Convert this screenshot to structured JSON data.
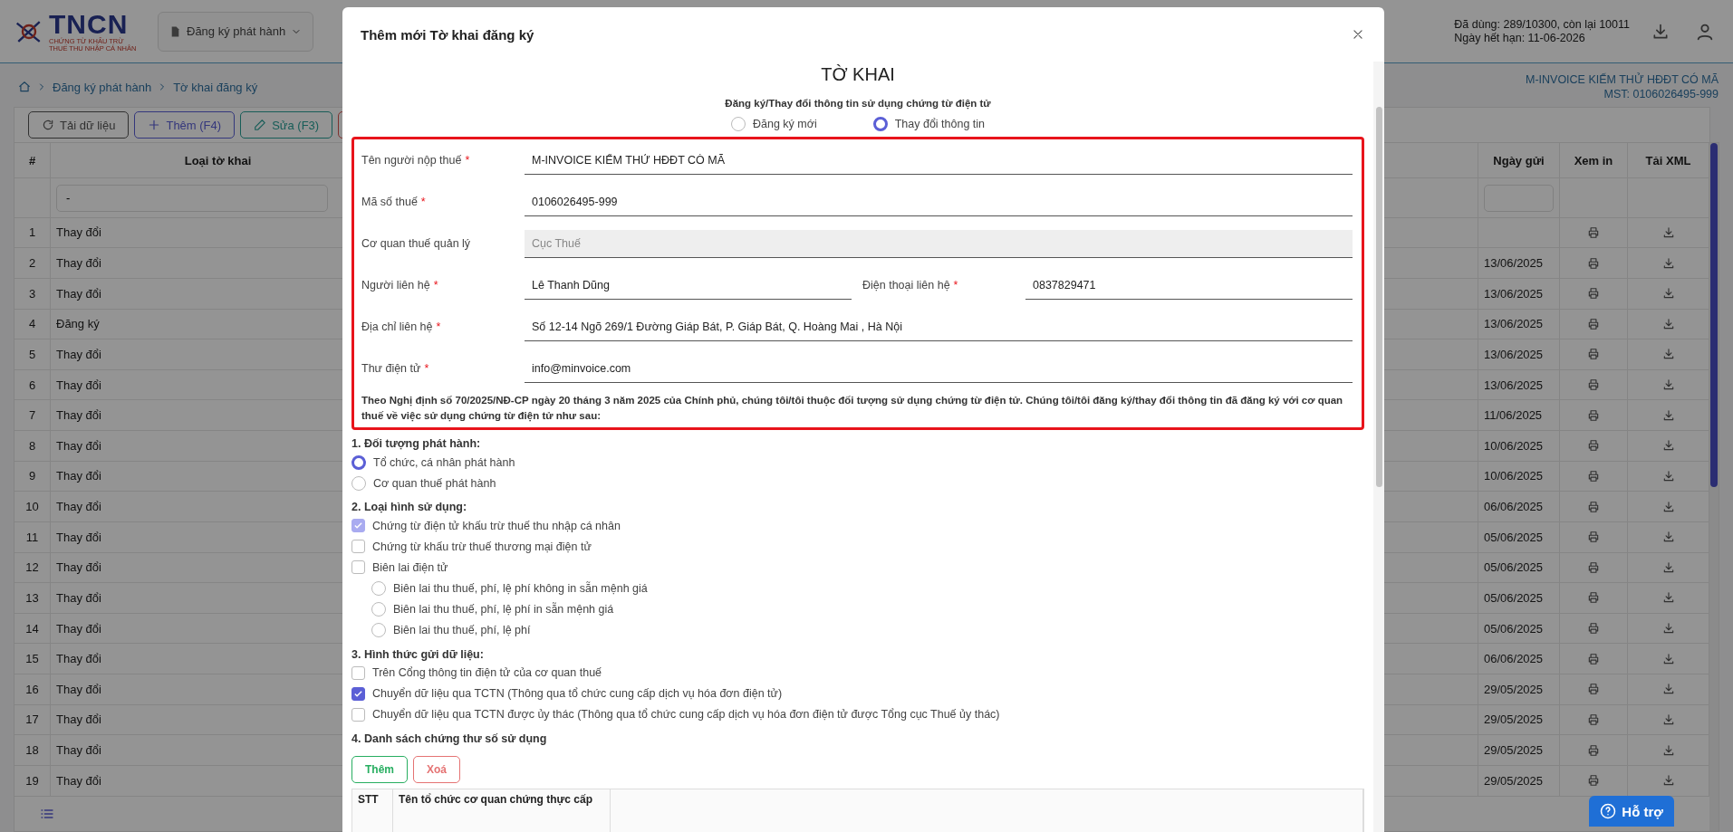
{
  "header": {
    "logo_text": "TNCN",
    "logo_tagline": "CHỨNG TỪ KHẤU TRỪ THUẾ THU NHẬP CÁ NHÂN",
    "menu_button": "Đăng ký phát hành",
    "usage": "Đã dùng: 289/10300, còn lại 10011",
    "expiry": "Ngày hết hạn: 11-06-2026"
  },
  "breadcrumb": [
    "Đăng ký phát hành",
    "Tờ khai đăng ký"
  ],
  "company": {
    "name": "M-INVOICE KIẾM THỬ HĐĐT CÓ MÃ",
    "tax_code": "MST: 0106026495-999"
  },
  "toolbar": [
    {
      "kind": "reload",
      "label": "Tải dữ liệu"
    },
    {
      "kind": "add",
      "label": "Thêm (F4)"
    },
    {
      "kind": "edit",
      "label": "Sửa (F3)"
    },
    {
      "kind": "delete"
    }
  ],
  "table": {
    "columns": [
      "#",
      "Loại tờ khai",
      "Ngày gửi",
      "Xem in",
      "Tải XML"
    ],
    "filter_value": "-",
    "rows": [
      {
        "no": "1",
        "type": "Thay đổi"
      },
      {
        "no": "2",
        "type": "Thay đổi",
        "date": "13/06/2025"
      },
      {
        "no": "3",
        "type": "Thay đổi",
        "date": "13/06/2025"
      },
      {
        "no": "4",
        "type": "Đăng ký",
        "date": "13/06/2025"
      },
      {
        "no": "5",
        "type": "Thay đổi",
        "date": "13/06/2025"
      },
      {
        "no": "6",
        "type": "Thay đổi",
        "date": "13/06/2025"
      },
      {
        "no": "7",
        "type": "Thay đổi",
        "date": "11/06/2025"
      },
      {
        "no": "8",
        "type": "Thay đổi",
        "date": "10/06/2025"
      },
      {
        "no": "9",
        "type": "Thay đổi",
        "date": "10/06/2025"
      },
      {
        "no": "10",
        "type": "Thay đổi",
        "date": "06/06/2025"
      },
      {
        "no": "11",
        "type": "Thay đổi",
        "date": "05/06/2025"
      },
      {
        "no": "12",
        "type": "Thay đổi",
        "date": "05/06/2025"
      },
      {
        "no": "13",
        "type": "Thay đổi",
        "date": "05/06/2025"
      },
      {
        "no": "14",
        "type": "Thay đổi",
        "date": "05/06/2025"
      },
      {
        "no": "15",
        "type": "Thay đổi",
        "date": "06/06/2025"
      },
      {
        "no": "16",
        "type": "Thay đổi",
        "date": "29/05/2025"
      },
      {
        "no": "17",
        "type": "Thay đổi",
        "date": "29/05/2025"
      },
      {
        "no": "18",
        "type": "Thay đổi",
        "date": "29/05/2025"
      },
      {
        "no": "19",
        "type": "Thay đổi",
        "date": "29/05/2025"
      }
    ]
  },
  "help_button": "Hỗ trợ",
  "modal": {
    "title": "Thêm mới Tờ khai đăng ký",
    "heading": "TỜ KHAI",
    "subtitle": "Đăng ký/Thay đổi thông tin sử dụng chứng từ điện tử",
    "mode_options": [
      {
        "label": "Đăng ký mới",
        "selected": false
      },
      {
        "label": "Thay đổi thông tin",
        "selected": true
      }
    ],
    "field_rows": [
      [
        {
          "label": "Tên người nộp thuế",
          "required_mark": "*",
          "value": "M-INVOICE KIẾM THỬ HĐĐT CÓ MÃ",
          "disabled": false
        }
      ],
      [
        {
          "label": "Mã số thuế",
          "required_mark": "*",
          "value": "0106026495-999",
          "disabled": false
        }
      ],
      [
        {
          "label": "Cơ quan thuế quản lý",
          "value": "Cục Thuế",
          "disabled": true
        }
      ],
      [
        {
          "label": "Người liên hệ",
          "required_mark": "*",
          "value": "Lê Thanh Dũng",
          "disabled": false
        },
        {
          "label": "Điện thoại liên hệ",
          "required_mark": "*",
          "value": "0837829471",
          "disabled": false
        }
      ],
      [
        {
          "label": "Địa chỉ liên hệ",
          "required_mark": "*",
          "value": "Số 12-14 Ngõ 269/1 Đường Giáp Bát, P. Giáp Bát, Q. Hoàng Mai , Hà Nội",
          "disabled": false
        }
      ],
      [
        {
          "label": "Thư điện tử",
          "required_mark": "*",
          "value": "info@minvoice.com",
          "disabled": false
        }
      ]
    ],
    "declaration": "Theo Nghị định số 70/2025/NĐ-CP ngày 20 tháng 3 năm 2025 của Chính phủ, chúng tôi/tôi thuộc đối tượng sử dụng chứng từ điện tử. Chúng tôi/tôi đăng ký/thay đổi thông tin đã đăng ký với cơ quan thuế về việc sử dụng chứng từ điện tử như sau:",
    "sections": [
      {
        "title": "1. Đối tượng phát hành:",
        "options": [
          {
            "kind": "radio",
            "label": "Tổ chức, cá nhân phát hành",
            "checked": true
          },
          {
            "kind": "radio",
            "label": "Cơ quan thuế phát hành",
            "checked": false
          }
        ]
      },
      {
        "title": "2. Loại hình sử dụng:",
        "options": [
          {
            "kind": "checkbox",
            "label": "Chứng từ điện tử khấu trừ thuế thu nhập cá nhân",
            "checked": true,
            "disabled": true
          },
          {
            "kind": "checkbox",
            "label": "Chứng từ khấu trừ thuế thương mại điện tử",
            "checked": false,
            "disabled": false
          },
          {
            "kind": "checkbox",
            "label": "Biên lai điện tử",
            "checked": false,
            "disabled": false,
            "children": [
              {
                "kind": "radio",
                "label": "Biên lai thu thuế, phí, lệ phí không in sẵn mệnh giá",
                "checked": false
              },
              {
                "kind": "radio",
                "label": "Biên lai thu thuế, phí, lệ phí in sẵn mệnh giá",
                "checked": false
              },
              {
                "kind": "radio",
                "label": "Biên lai thu thuế, phí, lệ phí",
                "checked": false
              }
            ]
          }
        ]
      },
      {
        "title": "3. Hình thức gửi dữ liệu:",
        "options": [
          {
            "kind": "checkbox",
            "label": "Trên Cổng thông tin điện tử của cơ quan thuế",
            "checked": false,
            "disabled": false
          },
          {
            "kind": "checkbox",
            "label": "Chuyển dữ liệu qua TCTN (Thông qua tổ chức cung cấp dịch vụ hóa đơn điện tử)",
            "checked": true,
            "disabled": false
          },
          {
            "kind": "checkbox",
            "label": "Chuyển dữ liệu qua TCTN được ủy thác (Thông qua tổ chức cung cấp dịch vụ hóa đơn điện tử được Tổng cục Thuế ủy thác)",
            "checked": false,
            "disabled": false
          }
        ]
      }
    ],
    "certificates": {
      "title": "4. Danh sách chứng thư số sử dụng",
      "buttons": [
        {
          "kind": "add",
          "label": "Thêm"
        },
        {
          "kind": "delete",
          "label": "Xoá"
        }
      ],
      "columns": [
        "STT",
        "Tên tổ chức cơ quan chứng thực cấp"
      ]
    }
  }
}
